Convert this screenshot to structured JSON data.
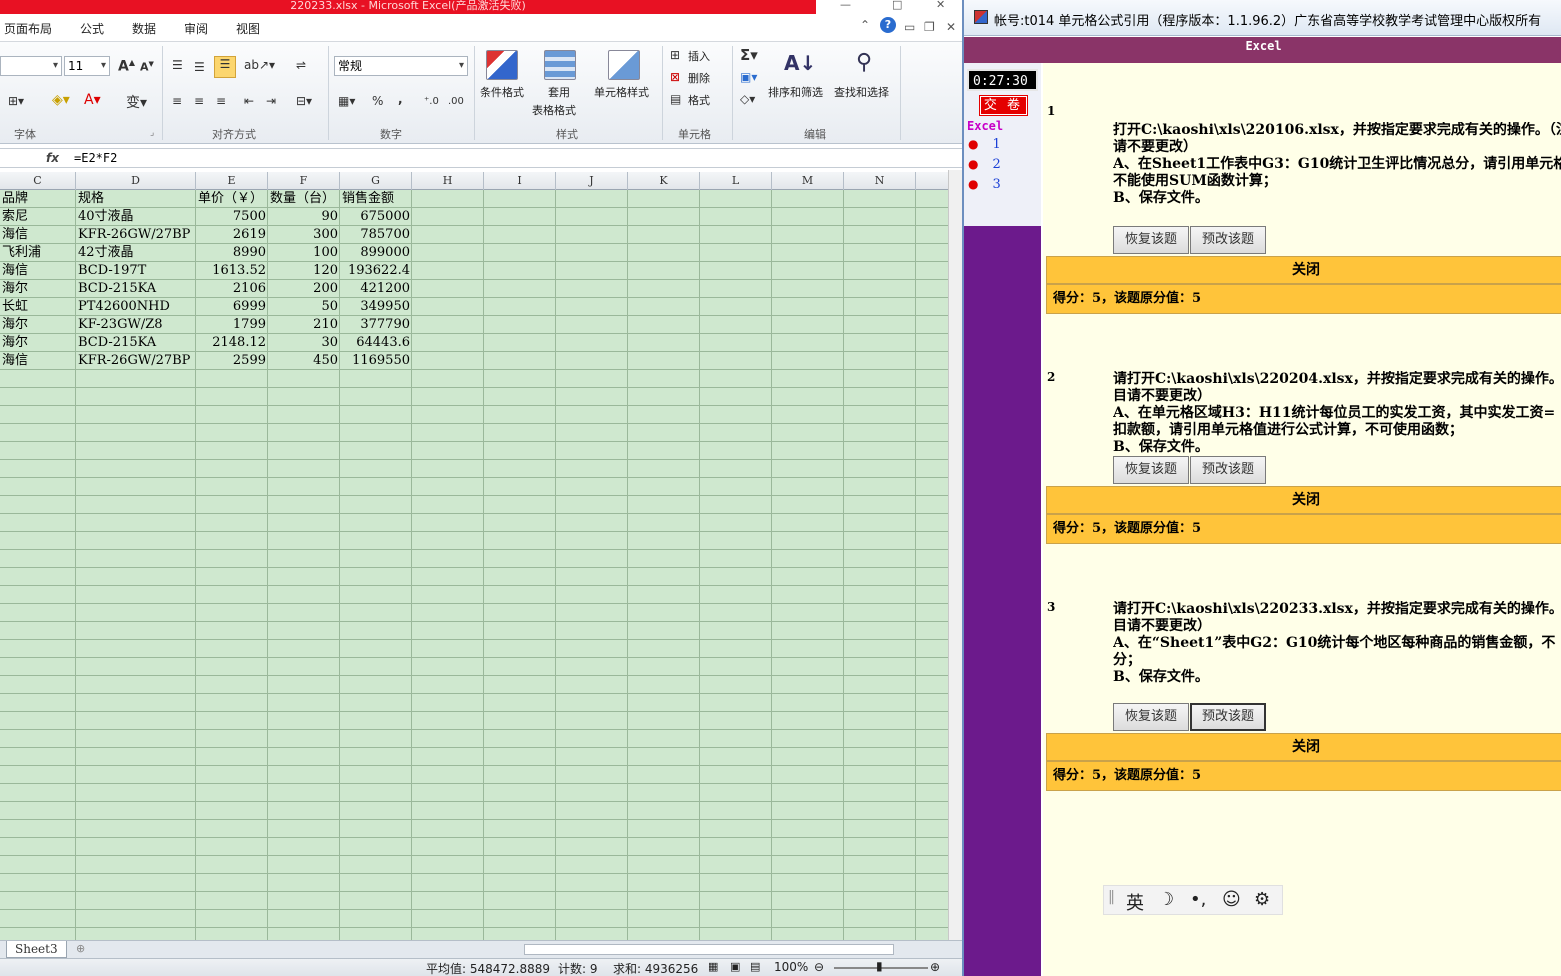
{
  "excel": {
    "title": "220233.xlsx - Microsoft Excel(产品激活失败)",
    "menu": [
      "页面布局",
      "公式",
      "数据",
      "审阅",
      "视图"
    ],
    "ribbon": {
      "font_size": "11",
      "number_format": "常规",
      "groups": [
        "字体",
        "对齐方式",
        "数字",
        "样式",
        "单元格",
        "编辑"
      ],
      "style_buttons": {
        "conditional": "条件格式",
        "table_format_1": "套用",
        "table_format_2": "表格格式",
        "cell_style": "单元格样式"
      },
      "cell_buttons": {
        "insert": "插入",
        "delete": "删除",
        "format": "格式"
      },
      "edit_buttons": {
        "sort_filter": "排序和筛选",
        "find_select": "查找和选择"
      }
    },
    "formula": "=E2*F2",
    "columns": [
      "C",
      "D",
      "E",
      "F",
      "G",
      "H",
      "I",
      "J",
      "K",
      "L",
      "M",
      "N"
    ],
    "rows": [
      [
        "品牌",
        "规格",
        "单价（￥）",
        "数量（台）",
        "销售金额"
      ],
      [
        "索尼",
        "40寸液晶",
        "7500",
        "90",
        "675000"
      ],
      [
        "海信",
        "KFR-26GW/27BP",
        "2619",
        "300",
        "785700"
      ],
      [
        "飞利浦",
        "42寸液晶",
        "8990",
        "100",
        "899000"
      ],
      [
        "海信",
        "BCD-197T",
        "1613.52",
        "120",
        "193622.4"
      ],
      [
        "海尔",
        "BCD-215KA",
        "2106",
        "200",
        "421200"
      ],
      [
        "长虹",
        "PT42600NHD",
        "6999",
        "50",
        "349950"
      ],
      [
        "海尔",
        "KF-23GW/Z8",
        "1799",
        "210",
        "377790"
      ],
      [
        "海尔",
        "BCD-215KA",
        "2148.12",
        "30",
        "64443.6"
      ],
      [
        "海信",
        "KFR-26GW/27BP",
        "2599",
        "450",
        "1169550"
      ]
    ],
    "sheet_tab": "Sheet3",
    "status": {
      "average": "平均值: 548472.8889",
      "count": "计数: 9",
      "sum": "求和: 4936256",
      "zoom": "100%"
    }
  },
  "exam": {
    "title": "帐号:t014  单元格公式引用（程序版本：1.1.96.2）广东省高等学校教学考试管理中心版权所有",
    "header": "Excel",
    "timer": "0:27:30",
    "submit": "交 卷",
    "side_label": "Excel",
    "side_items": [
      "1",
      "2",
      "3"
    ],
    "questions": [
      {
        "num": "1",
        "lines": [
          "打开C:\\kaoshi\\xls\\220106.xlsx，并按指定要求完成有关的操作。（注：",
          "请不要更改）",
          "A、在Sheet1工作表中G3：G10统计卫生评比情况总分，请引用单元格",
          "不能使用SUM函数计算；",
          "B、保存文件。"
        ],
        "restore": "恢复该题",
        "edit": "预改该题",
        "close": "关闭",
        "score": "得分：5，该题原分值：5"
      },
      {
        "num": "2",
        "lines": [
          "请打开C:\\kaoshi\\xls\\220204.xlsx，并按指定要求完成有关的操作。（注",
          "目请不要更改）",
          "A、在单元格区域H3：H11统计每位员工的实发工资，其中实发工资=",
          "扣款额，请引用单元格值进行公式计算，不可使用函数；",
          "B、保存文件。"
        ],
        "restore": "恢复该题",
        "edit": "预改该题",
        "close": "关闭",
        "score": "得分：5，该题原分值：5"
      },
      {
        "num": "3",
        "lines": [
          "请打开C:\\kaoshi\\xls\\220233.xlsx，并按指定要求完成有关的操作。（注",
          "目请不要更改）",
          "A、在“Sheet1”表中G2：G10统计每个地区每种商品的销售金额，不",
          "分；",
          "B、保存文件。"
        ],
        "restore": "恢复该题",
        "edit": "预改该题",
        "close": "关闭",
        "score": "得分：5，该题原分值：5"
      }
    ]
  },
  "ime": {
    "lang": "英",
    "icons": [
      "moon-icon",
      "punctuation-icon",
      "emoji-icon",
      "gear-icon"
    ]
  }
}
